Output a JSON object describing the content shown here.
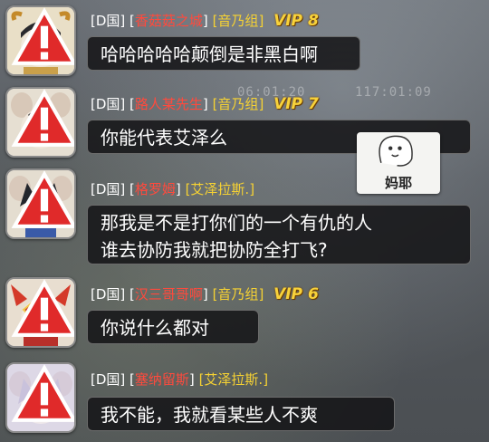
{
  "background": {
    "timer_1": "06:01:20",
    "timer_2": "117:01:09"
  },
  "messages": [
    {
      "server": "[D国]",
      "name": "香菇菇之城",
      "guild": "音乃组",
      "vip": "VIP 8",
      "lines": [
        "哈哈哈哈哈颠倒是非黑白啊"
      ]
    },
    {
      "server": "[D国]",
      "name": "路人某先生",
      "guild": "音乃组",
      "vip": "VIP 7",
      "lines": [
        "你能代表艾泽么"
      ]
    },
    {
      "server": "[D国]",
      "name": "格罗姆",
      "guild": "艾泽拉斯.",
      "vip": "",
      "lines": [
        "那我是不是打你们的一个有仇的人",
        "谁去协防我就把协防全打飞?"
      ]
    },
    {
      "server": "[D国]",
      "name": "汉三哥哥啊",
      "guild": "音乃组",
      "vip": "VIP 6",
      "lines": [
        "你说什么都对"
      ]
    },
    {
      "server": "[D国]",
      "name": "塞纳留斯",
      "guild": "艾泽拉斯.",
      "vip": "",
      "lines": [
        "我不能，我就看某些人不爽"
      ]
    }
  ],
  "sticker": {
    "caption": "妈耶"
  },
  "colors": {
    "name": "#ff4a3d",
    "guild": "#f6d233",
    "vip": "#f8d23a",
    "bubble_bg": "#141416"
  }
}
